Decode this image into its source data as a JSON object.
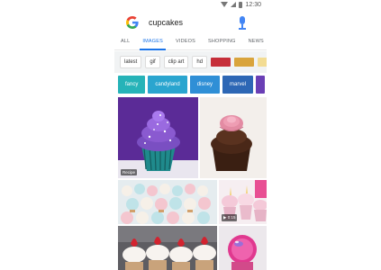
{
  "status_bar": {
    "time": "12:30"
  },
  "search": {
    "logo": "G",
    "query": "cupcakes"
  },
  "tabs": [
    "ALL",
    "IMAGES",
    "VIDEOS",
    "SHOPPING",
    "NEWS"
  ],
  "filter_chips": [
    "latest",
    "gif",
    "clip art",
    "hd"
  ],
  "color_chips": [
    "#c62f3a",
    "#d9a43c",
    "#f3dc93"
  ],
  "topic_chips": [
    {
      "label": "fancy",
      "color": "#26b3b8"
    },
    {
      "label": "candyland",
      "color": "#2aa5cf"
    },
    {
      "label": "disney",
      "color": "#2f8fd6"
    },
    {
      "label": "marvel",
      "color": "#2d67b5"
    },
    {
      "label": "",
      "color": "#6a3fb5"
    }
  ],
  "results": {
    "tile1_badge": "Recipe",
    "tile3_badge": "▶ 0:15"
  }
}
